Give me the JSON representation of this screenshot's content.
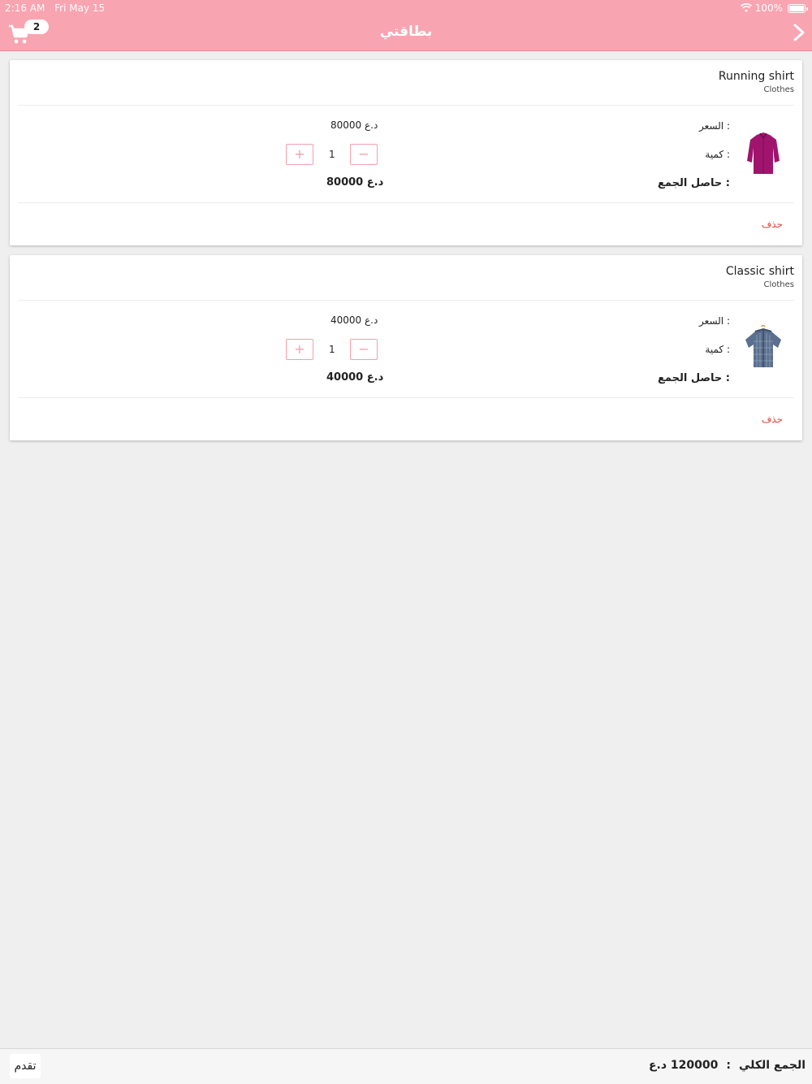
{
  "status": {
    "time": "2:16 AM",
    "date": "Fri May 15",
    "battery": "100%"
  },
  "nav": {
    "title": "بطاقتي",
    "cart_count": "2"
  },
  "labels": {
    "price": "السعر :",
    "quantity": "كمية :",
    "subtotal": "حاصل الجمع  :",
    "delete": "حذف"
  },
  "items": [
    {
      "name": "Running shirt",
      "category": "Clothes",
      "price": "80000 د.ع",
      "quantity": "1",
      "subtotal": "80000 د.ع"
    },
    {
      "name": "Classic shirt",
      "category": "Clothes",
      "price": "40000 د.ع",
      "quantity": "1",
      "subtotal": "40000 د.ع"
    }
  ],
  "footer": {
    "proceed_label": "تقدم",
    "grand_total_label": "الجمع الكلي",
    "grand_total_sep": ":",
    "grand_total_value": "120000 د.ع"
  },
  "colors": {
    "accent": "#f9a4b1",
    "delete": "#e0473a"
  },
  "icons": {
    "cart": "cart-icon",
    "back": "chevron-right-icon",
    "plus": "plus-icon",
    "minus": "minus-icon"
  }
}
